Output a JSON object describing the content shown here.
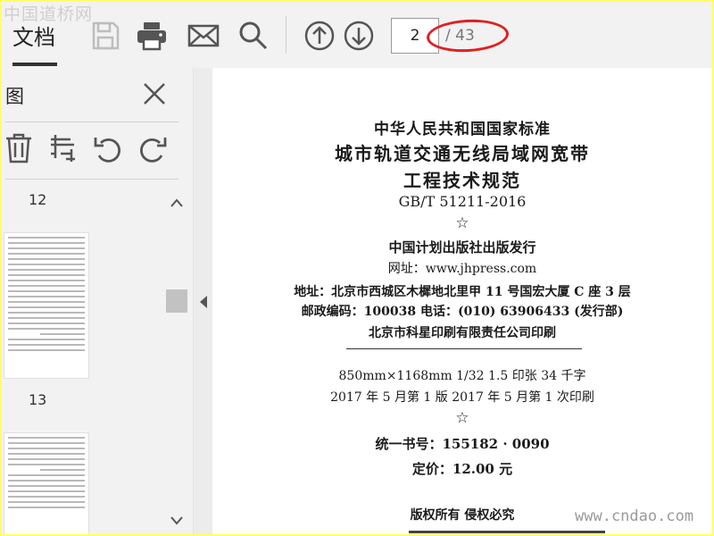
{
  "watermark_top": "中国道桥网",
  "watermark_bottom": "www.cndao.com",
  "toolbar": {
    "tab_label": "文档",
    "page_current": "2",
    "page_total": "/ 43",
    "icons": [
      "save-icon",
      "print-icon",
      "mail-icon",
      "search-icon",
      "arrow-up-icon",
      "arrow-down-icon"
    ]
  },
  "sidebar": {
    "title": "图",
    "tools": [
      "trash-icon",
      "crop-icon",
      "undo-icon",
      "redo-icon"
    ],
    "thumbnails": [
      {
        "page": "12"
      },
      {
        "page": "13"
      }
    ]
  },
  "document": {
    "line1": "中华人民共和国国家标准",
    "line2": "城市轨道交通无线局域网宽带",
    "line3": "工程技术规范",
    "line4": "GB/T 51211-2016",
    "star": "☆",
    "line5": "中国计划出版社出版发行",
    "line6": "网址：www.jhpress.com",
    "line7": "地址：北京市西城区木樨地北里甲 11 号国宏大厦 C 座 3 层",
    "line8": "邮政编码：100038 电话：(010) 63906433 (发行部)",
    "line9": "北京市科星印刷有限责任公司印刷",
    "line10": "850mm×1168mm 1/32 1.5 印张 34 千字",
    "line11": "2017 年 5 月第 1 版 2017 年 5 月第 1 次印刷",
    "line12": "统一书号：155182 · 0090",
    "line13": "定价：12.00 元",
    "line14": "版权所有 侵权必究"
  },
  "colors": {
    "frame_border": "#ffff66",
    "annotation_ellipse": "#e02020"
  }
}
